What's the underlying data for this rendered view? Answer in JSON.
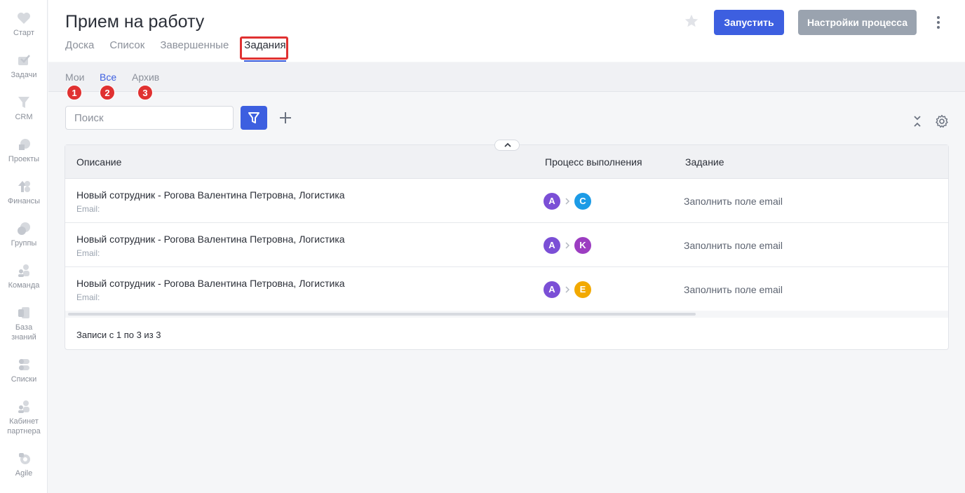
{
  "sidebar": {
    "items": [
      {
        "label": "Старт",
        "icon": "heart-icon"
      },
      {
        "label": "Задачи",
        "icon": "tasks-icon"
      },
      {
        "label": "CRM",
        "icon": "crm-icon"
      },
      {
        "label": "Проекты",
        "icon": "projects-icon"
      },
      {
        "label": "Финансы",
        "icon": "finance-icon"
      },
      {
        "label": "Группы",
        "icon": "groups-icon"
      },
      {
        "label": "Команда",
        "icon": "team-icon"
      },
      {
        "label": "База\nзнаний",
        "label_line1": "База",
        "label_line2": "знаний",
        "icon": "knowledge-base-icon"
      },
      {
        "label": "Списки",
        "icon": "lists-icon"
      },
      {
        "label": "Кабинет\nпартнера",
        "label_line1": "Кабинет",
        "label_line2": "партнера",
        "icon": "partner-icon"
      },
      {
        "label": "Agile",
        "icon": "agile-icon"
      }
    ]
  },
  "header": {
    "title": "Прием на работу",
    "tabs": [
      {
        "label": "Доска"
      },
      {
        "label": "Список"
      },
      {
        "label": "Завершенные"
      },
      {
        "label": "Задания",
        "active": true
      }
    ],
    "run_button": "Запустить",
    "settings_button": "Настройки процесса"
  },
  "subtabs": {
    "items": [
      {
        "label": "Мои",
        "badge": "1"
      },
      {
        "label": "Все",
        "badge": "2",
        "active": true
      },
      {
        "label": "Архив",
        "badge": "3"
      }
    ]
  },
  "toolbar": {
    "search_placeholder": "Поиск"
  },
  "table": {
    "columns": [
      "Описание",
      "Процесс выполнения",
      "Задание"
    ],
    "rows": [
      {
        "title": "Новый сотрудник - Рогова Валентина Петровна, Логистика",
        "sub": "Email:",
        "from": "A",
        "to": "C",
        "to_color": "#1c9be6",
        "task": "Заполнить поле email"
      },
      {
        "title": "Новый сотрудник - Рогова Валентина Петровна, Логистика",
        "sub": "Email:",
        "from": "A",
        "to": "K",
        "to_color": "#9c3dc1",
        "task": "Заполнить поле email"
      },
      {
        "title": "Новый сотрудник - Рогова Валентина Петровна, Логистика",
        "sub": "Email:",
        "from": "A",
        "to": "E",
        "to_color": "#f2a900",
        "task": "Заполнить поле email"
      }
    ],
    "footer": "Записи с 1 по 3 из 3"
  },
  "colors": {
    "accent": "#3d5fe0",
    "avatar_from": "#7b4fd6",
    "highlight": "#e03131"
  }
}
